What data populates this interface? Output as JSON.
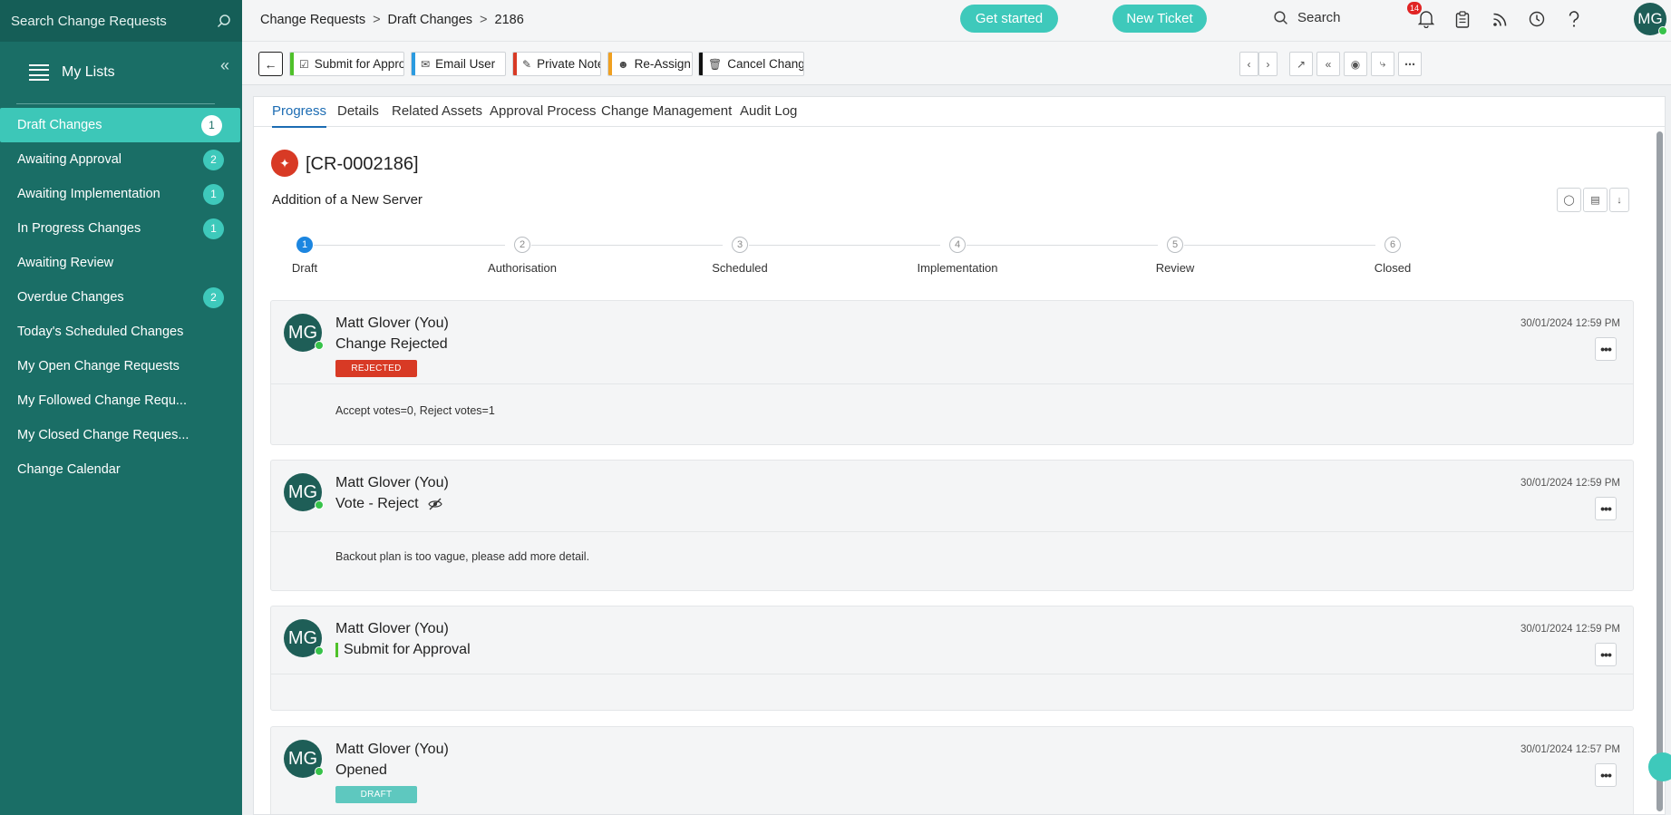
{
  "sidebar": {
    "search_placeholder": "Search Change Requests",
    "title": "My Lists",
    "items": [
      {
        "label": "Draft Changes",
        "count": "1"
      },
      {
        "label": "Awaiting Approval",
        "count": "2"
      },
      {
        "label": "Awaiting Implementation",
        "count": "1"
      },
      {
        "label": "In Progress Changes",
        "count": "1"
      },
      {
        "label": "Awaiting Review",
        "count": ""
      },
      {
        "label": "Overdue Changes",
        "count": "2"
      },
      {
        "label": "Today's Scheduled Changes",
        "count": ""
      },
      {
        "label": "My Open Change Requests",
        "count": ""
      },
      {
        "label": "My Followed Change Requ...",
        "count": ""
      },
      {
        "label": "My Closed Change Reques...",
        "count": ""
      },
      {
        "label": "Change Calendar",
        "count": ""
      }
    ]
  },
  "topbar": {
    "breadcrumb": [
      "Change Requests",
      "Draft Changes",
      "2186"
    ],
    "get_started": "Get started",
    "new_ticket": "New Ticket",
    "search_label": "Search",
    "notifications_count": "14",
    "avatar_initials": "MG"
  },
  "toolbar": {
    "submit": "Submit for Appro...",
    "email": "Email User",
    "private_note": "Private Note",
    "reassign": "Re-Assign",
    "cancel": "Cancel Change"
  },
  "tabs": [
    "Progress",
    "Details",
    "Related Assets",
    "Approval Process",
    "Change Management",
    "Audit Log"
  ],
  "request": {
    "id": "[CR-0002186]",
    "summary": "Addition of a New Server"
  },
  "stepper": [
    {
      "num": "1",
      "label": "Draft"
    },
    {
      "num": "2",
      "label": "Authorisation"
    },
    {
      "num": "3",
      "label": "Scheduled"
    },
    {
      "num": "4",
      "label": "Implementation"
    },
    {
      "num": "5",
      "label": "Review"
    },
    {
      "num": "6",
      "label": "Closed"
    }
  ],
  "feed": [
    {
      "initials": "MG",
      "user": "Matt Glover (You)",
      "action": "Change Rejected",
      "tag": "REJECTED",
      "time": "30/01/2024 12:59 PM",
      "body": "Accept votes=0, Reject votes=1"
    },
    {
      "initials": "MG",
      "user": "Matt Glover (You)",
      "action": "Vote - Reject",
      "time": "30/01/2024 12:59 PM",
      "body": "Backout plan is too vague, please add more detail."
    },
    {
      "initials": "MG",
      "user": "Matt Glover (You)",
      "action": "Submit for Approval",
      "time": "30/01/2024 12:59 PM",
      "body": ""
    },
    {
      "initials": "MG",
      "user": "Matt Glover (You)",
      "action": "Opened",
      "tag": "DRAFT",
      "time": "30/01/2024 12:57 PM",
      "body": ""
    }
  ],
  "colors": {
    "sidebar_bg": "#1a6e66",
    "accent": "#3ec9bb",
    "rejected": "#d83a25",
    "draft": "#5ec8bf",
    "active_tab": "#1c6cb3"
  }
}
